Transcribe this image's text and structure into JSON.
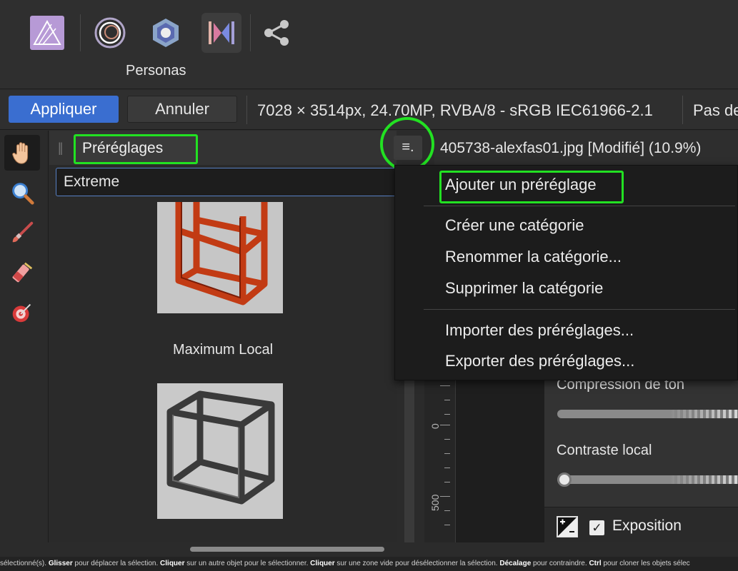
{
  "personas": {
    "label": "Personas",
    "items": [
      {
        "name": "photo-persona",
        "active": false
      },
      {
        "name": "liquify-persona",
        "active": false
      },
      {
        "name": "develop-persona",
        "active": false
      },
      {
        "name": "tone-mapping-persona",
        "active": true
      },
      {
        "name": "export-persona",
        "active": false
      }
    ]
  },
  "context_toolbar": {
    "apply_label": "Appliquer",
    "cancel_label": "Annuler",
    "image_info": "7028 × 3514px, 24.70MP, RVBA/8 - sRGB IEC61966-2.1",
    "trailing_text": "Pas de"
  },
  "tools": [
    {
      "name": "hand-tool-icon",
      "active": true
    },
    {
      "name": "zoom-tool-icon",
      "active": false
    },
    {
      "name": "brush-tool-icon",
      "active": false
    },
    {
      "name": "eraser-tool-icon",
      "active": false
    },
    {
      "name": "target-tool-icon",
      "active": false
    }
  ],
  "presets_panel": {
    "tab_label": "Préréglages",
    "category": "Extreme",
    "presets": [
      {
        "label": "Maximum Local"
      },
      {
        "label": ""
      }
    ]
  },
  "menu_button_glyph": "≡.",
  "dropdown": {
    "items": [
      {
        "label": "Ajouter un préréglage",
        "highlighted": true
      },
      {
        "label": "Créer une catégorie"
      },
      {
        "label": "Renommer la catégorie..."
      },
      {
        "label": "Supprimer la catégorie"
      },
      {
        "label": "Importer des préréglages..."
      },
      {
        "label": "Exporter des préréglages..."
      }
    ]
  },
  "document": {
    "title": "405738-alexfas01.jpg [Modifié] (10.9%)",
    "ruler_labels": [
      "0",
      "500"
    ]
  },
  "adjustments": {
    "tone_compression_label": "Compression de ton",
    "local_contrast_label": "Contraste local",
    "exposure_label": "Exposition",
    "exposure_checked": true,
    "check_glyph": "✓"
  },
  "status_bar": {
    "t1": "sélectionné(s).",
    "k1": "Glisser",
    "t2": "pour déplacer la sélection.",
    "k2": "Cliquer",
    "t3": "sur un autre objet pour le sélectionner.",
    "k3": "Cliquer",
    "t4": "sur une zone vide pour désélectionner la sélection.",
    "k4": "Décalage",
    "t5": "pour contraindre.",
    "k5": "Ctrl",
    "t6": "pour cloner les objets sélec"
  },
  "colors": {
    "accent_blue": "#3a6ed0",
    "highlight_green": "#22e122",
    "preset_red": "#c23b14"
  }
}
